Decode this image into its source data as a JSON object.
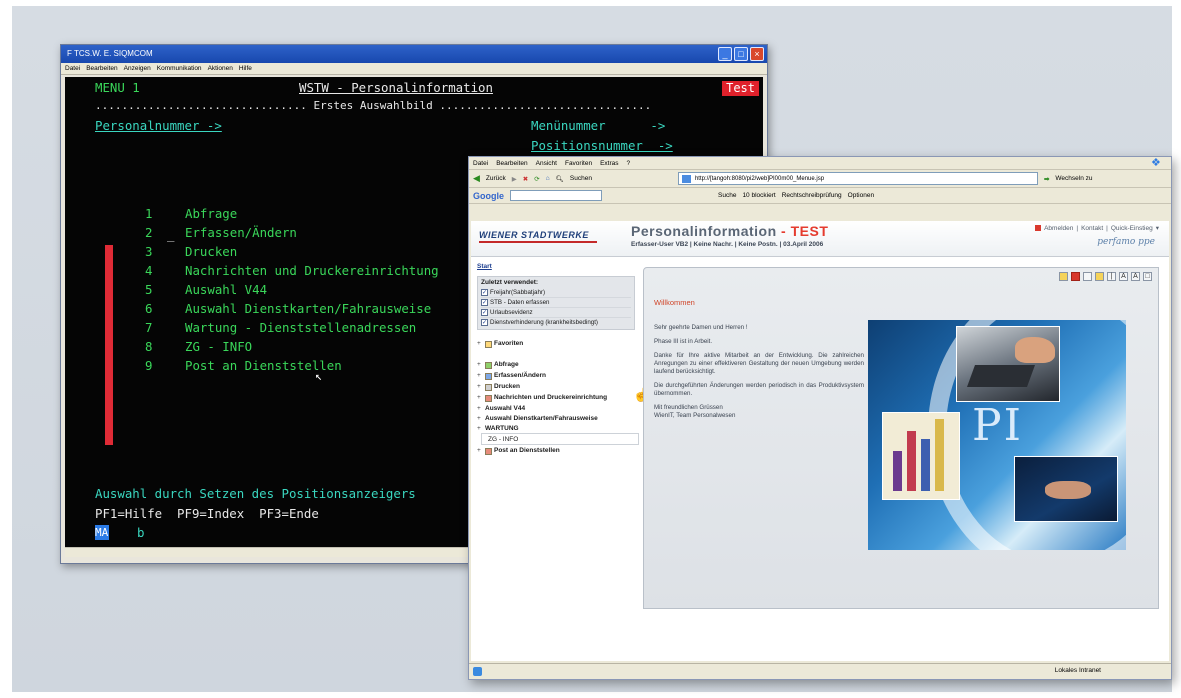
{
  "terminal": {
    "title": "F TCS.W. E. SIQMCOM",
    "menubar": [
      "Datei",
      "Bearbeiten",
      "Anzeigen",
      "Kommunikation",
      "Aktionen",
      "Hilfe"
    ],
    "menu_label": "MENU 1",
    "screen_title": "WSTW - Personalinformation",
    "test_badge": "Test",
    "subtitle_line": "................................ Erstes Auswahlbild ................................",
    "personalnummer": "Personalnummer ->",
    "menuenummer": "Menünummer      ->",
    "positionsnummer": "Positionsnummer  ->",
    "cursor_mark": "_",
    "items": [
      {
        "num": "1",
        "label": "Abfrage"
      },
      {
        "num": "2",
        "label": "Erfassen/Ändern"
      },
      {
        "num": "3",
        "label": "Drucken"
      },
      {
        "num": "4",
        "label": "Nachrichten und Druckereinrichtung"
      },
      {
        "num": "5",
        "label": "Auswahl V44"
      },
      {
        "num": "6",
        "label": "Auswahl Dienstkarten/Fahrausweise"
      },
      {
        "num": "7",
        "label": "Wartung - Dienststellenadressen"
      },
      {
        "num": "8",
        "label": "ZG - INFO"
      },
      {
        "num": "9",
        "label": "Post an Dienststellen"
      }
    ],
    "hint": "Auswahl durch Setzen des Positionsanzeigers",
    "pf_keys": "PF1=Hilfe  PF9=Index  PF3=Ende",
    "input_prefix": "MA",
    "input_value": "b"
  },
  "browser": {
    "menubar": [
      "Datei",
      "Bearbeiten",
      "Ansicht",
      "Favoriten",
      "Extras",
      "?"
    ],
    "back_label": "Zurück",
    "search_label": "Suchen",
    "address_url": "http://[tangoh:8080/pi2/web]PI00m00_Menue.jsp",
    "go_label": "Wechseln zu",
    "google_search": "Suche",
    "blocked": "10 blockiert",
    "spellcheck": "Rechtschreibprüfung",
    "options": "Optionen",
    "status_zone": "Lokales Intranet"
  },
  "page": {
    "brand": "WIENER STADTWERKE",
    "title_main": "Personalinformation",
    "title_sep": " - ",
    "title_test": "TEST",
    "subline": "Erfasser-User VB2  |  Keine Nachr.  |  Keine Postn.  |  03.April 2006",
    "links": [
      "Abmelden",
      "|",
      "Kontakt",
      "|",
      "Quick-Einstieg"
    ],
    "signature": "perfamo ppe",
    "nav_start": "Start",
    "recent_heading": "Zuletzt verwendet:",
    "recent_items": [
      "Freijahr(Sabbatjahr)",
      "STB - Daten erfassen",
      "Urlaubsevidenz",
      "Dienstverhinderung (krankheitsbedingt)"
    ],
    "favorites": "Favoriten",
    "tree": [
      {
        "label": "Abfrage",
        "icon": "green"
      },
      {
        "label": "Erfassen/Ändern",
        "icon": "blue"
      },
      {
        "label": "Drucken",
        "icon": "gray"
      },
      {
        "label": "Nachrichten und Druckereinrichtung",
        "icon": "red"
      },
      {
        "label": "Auswahl V44",
        "icon": "none"
      },
      {
        "label": "Auswahl Dienstkarten/Fahrausweise",
        "icon": "none"
      },
      {
        "label": "WARTUNG",
        "icon": "none"
      },
      {
        "label": "ZG - INFO",
        "icon": "sel"
      },
      {
        "label": "Post an Dienststellen",
        "icon": "red"
      }
    ],
    "welcome_title": "Willkommen",
    "welcome_paragraphs": [
      "Sehr geehrte Damen und Herren !",
      "Phase III ist in Arbeit.",
      "Danke für Ihre aktive Mitarbeit an der Entwicklung. Die zahlreichen Anregungen zu einer effektiveren Gestaltung der neuen Umgebung werden laufend berücksichtigt.",
      "Die durchgeführten Änderungen werden periodisch in das Produktivsystem übernommen.",
      "Mit freundlichen Grüssen\nWienIT, Team Personalwesen"
    ],
    "image_letters": "PI"
  }
}
